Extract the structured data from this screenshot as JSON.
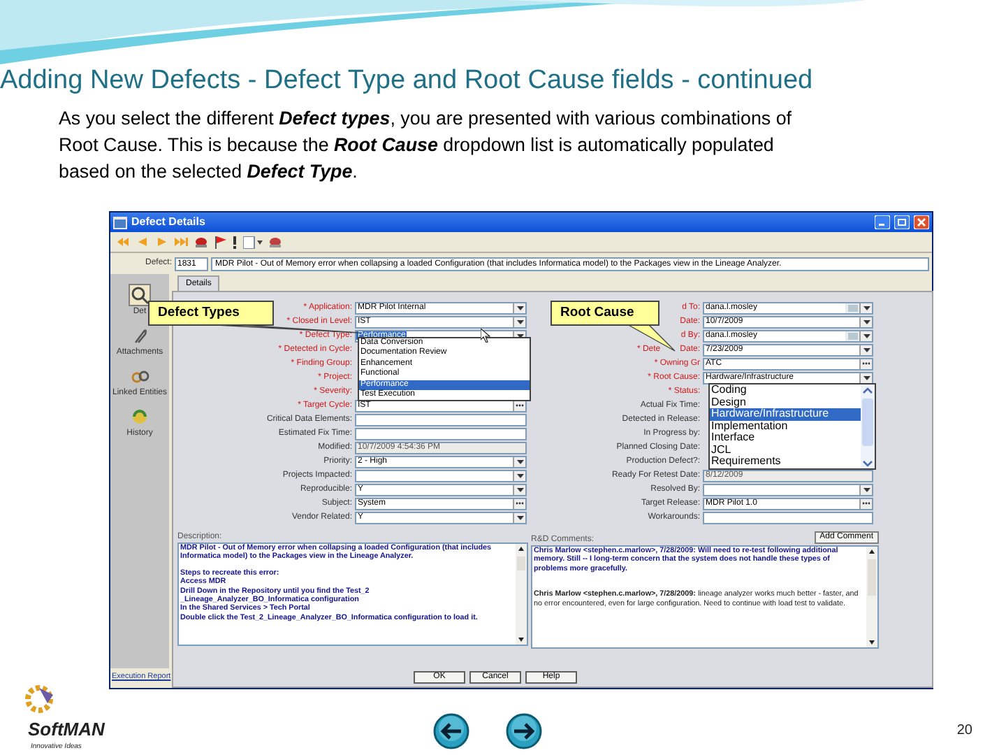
{
  "slide": {
    "title": "Adding New Defects - Defect Type and Root Cause fields - continued",
    "body": "As you select the different **Defect types**, you are presented with various combinations of Root Cause.  This is because the **Root Cause** dropdown list is automatically populated based on the selected **Defect Type**.",
    "logo": {
      "name": "SoftMAN",
      "tagline": "Innovative Ideas"
    },
    "page_number": "20"
  },
  "window": {
    "title": "Defect Details",
    "defect": {
      "label": "Defect:",
      "id": "1831",
      "summary": "MDR Pilot - Out of Memory error when collapsing a loaded Configuration (that includes Informatica model) to the Packages view in the Lineage Analyzer."
    },
    "sidebar": [
      {
        "label": "Det",
        "selected": true
      },
      {
        "label": "Attachments",
        "selected": false
      },
      {
        "label": "Linked Entities",
        "selected": false
      },
      {
        "label": "History",
        "selected": false
      }
    ],
    "tabs": [
      {
        "label": "Details",
        "selected": true
      }
    ],
    "left_fields": [
      {
        "label": "* Application:",
        "required": true,
        "kind": "dropdown",
        "value": "MDR Pilot Internal"
      },
      {
        "label": "* Closed in Level:",
        "required": true,
        "kind": "dropdown",
        "value": "IST"
      },
      {
        "label": "* Defect Type:",
        "required": true,
        "kind": "open",
        "value": "Performance"
      },
      {
        "label": "* Detected in Cycle:",
        "required": true,
        "kind": "covered"
      },
      {
        "label": "* Finding Group:",
        "required": true,
        "kind": "covered"
      },
      {
        "label": "* Project:",
        "required": true,
        "kind": "covered"
      },
      {
        "label": "* Severity:",
        "required": true,
        "kind": "covered"
      },
      {
        "label": "* Target Cycle:",
        "required": true,
        "kind": "lookup",
        "value": "IST"
      },
      {
        "label": "Critical Data Elements:",
        "required": false,
        "kind": "text"
      },
      {
        "label": "Estimated Fix Time:",
        "required": false,
        "kind": "text"
      },
      {
        "label": "Modified:",
        "required": false,
        "kind": "readonly",
        "value": "10/7/2009 4:54:36 PM"
      },
      {
        "label": "Priority:",
        "required": false,
        "kind": "dropdown",
        "value": "2 - High"
      },
      {
        "label": "Projects Impacted:",
        "required": false,
        "kind": "dropdown"
      },
      {
        "label": "Reproducible:",
        "required": false,
        "kind": "dropdown",
        "value": "Y"
      },
      {
        "label": "Subject:",
        "required": false,
        "kind": "lookup",
        "value": "System"
      },
      {
        "label": "Vendor Related:",
        "required": false,
        "kind": "dropdown",
        "value": "Y"
      }
    ],
    "right_fields": [
      {
        "label": "d To:",
        "required": true,
        "kind": "user",
        "value": "dana.l.mosley"
      },
      {
        "label": "Date:",
        "required": true,
        "kind": "dropdown",
        "value": "10/7/2009"
      },
      {
        "label": "d By:",
        "required": true,
        "kind": "user",
        "value": "dana.l.mosley"
      },
      {
        "label": "* Dete",
        "label_end": "Date:",
        "required": true,
        "kind": "dropdown",
        "value": "7/23/2009"
      },
      {
        "label": "* Owning Gr",
        "required": true,
        "kind": "lookup",
        "value": "ATC"
      },
      {
        "label": "* Root Cause:",
        "required": true,
        "kind": "dropdown",
        "value": "Hardware/Infrastructure"
      },
      {
        "label": "* Status:",
        "required": true,
        "kind": "covered"
      },
      {
        "label": "Actual Fix Time:",
        "required": false,
        "kind": "covered"
      },
      {
        "label": "Detected in Release:",
        "required": false,
        "kind": "covered"
      },
      {
        "label": "In Progress by:",
        "required": false,
        "kind": "covered"
      },
      {
        "label": "Planned Closing Date:",
        "required": false,
        "kind": "covered"
      },
      {
        "label": "Production Defect?:",
        "required": false,
        "kind": "covered"
      },
      {
        "label": "Ready For Retest Date:",
        "required": false,
        "kind": "readonly",
        "value": "8/12/2009"
      },
      {
        "label": "Resolved By:",
        "required": false,
        "kind": "dropdown"
      },
      {
        "label": "Target Release:",
        "required": false,
        "kind": "lookup",
        "value": "MDR Pilot 1.0"
      },
      {
        "label": "Workarounds:",
        "required": false,
        "kind": "text"
      }
    ],
    "defect_type_list": [
      {
        "label": "Data Conversion",
        "selected": false
      },
      {
        "label": "Documentation Review",
        "selected": false
      },
      {
        "label": "Enhancement",
        "selected": false
      },
      {
        "label": "Functional",
        "selected": false
      },
      {
        "label": "Performance",
        "selected": true
      },
      {
        "label": "Test Execution",
        "selected": false
      }
    ],
    "root_cause_list": [
      {
        "label": "Coding",
        "selected": false
      },
      {
        "label": "Design",
        "selected": false
      },
      {
        "label": "Hardware/Infrastructure",
        "selected": true
      },
      {
        "label": "Implementation",
        "selected": false
      },
      {
        "label": "Interface",
        "selected": false
      },
      {
        "label": "JCL",
        "selected": false
      },
      {
        "label": "Requirements",
        "selected": false
      }
    ],
    "description": {
      "label": "Description:",
      "paragraphs": [
        "MDR Pilot - Out of Memory error when collapsing a loaded Configuration (that includes Informatica model) to the Packages view in the Lineage Analyzer.",
        "Steps to recreate this error:\nAccess MDR\nDrill Down in the Repository until you find the Test_2\n_Lineage_Analyzer_BO_Informatica configuration\nIn the Shared Services  > Tech Portal\nDouble click the Test_2_Lineage_Analyzer_BO_Informatica configuration to load it."
      ]
    },
    "rd_comments": {
      "label": "R&D Comments:",
      "add_button": "Add Comment",
      "entries": [
        {
          "text": "Chris Marlow <stephen.c.marlow>, 7/28/2009:   Will need to re-test following additional memory.  Still -- I long-term concern that the system does not handle these types of problems more gracefully.",
          "emphasis": true
        },
        {
          "text": "**Chris Marlow <stephen.c.marlow>, 7/28/2009:**  lineage analyzer works much better - faster, and no error encountered, even for large configuration.  Need to continue with load test to validate.",
          "emphasis": false
        }
      ]
    },
    "execution_report": "Execution Report",
    "buttons": [
      "OK",
      "Cancel",
      "Help"
    ]
  },
  "callouts": [
    "Defect Types",
    "Root Cause"
  ]
}
